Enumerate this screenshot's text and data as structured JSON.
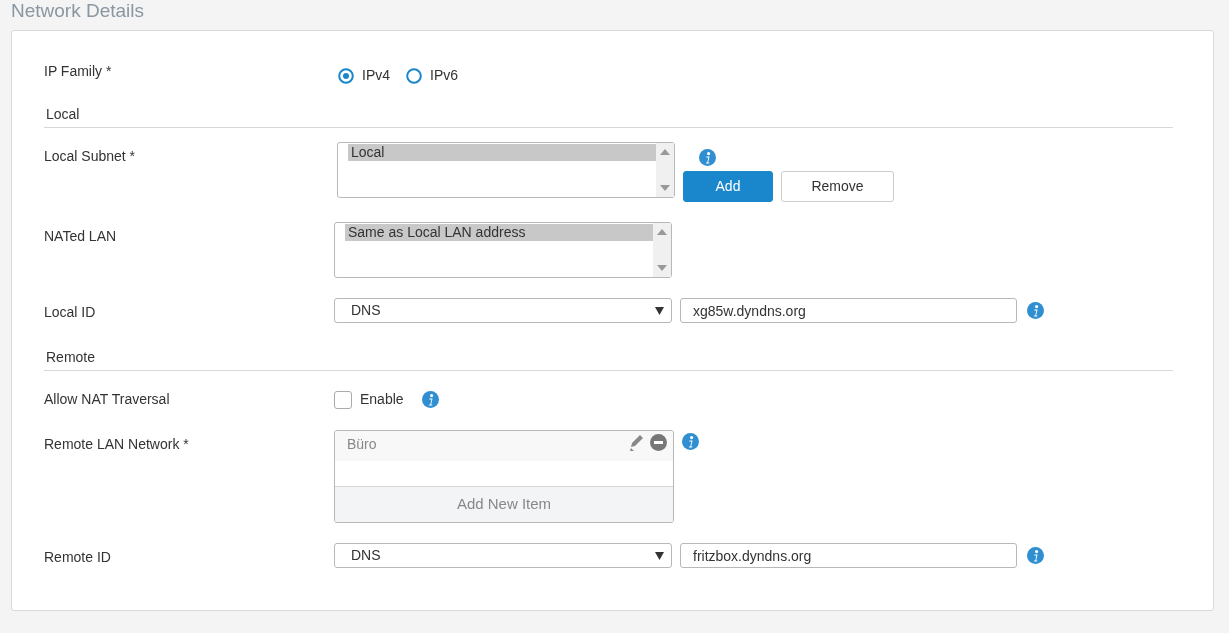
{
  "title": "Network Details",
  "ip_family": {
    "label": "IP Family *",
    "options": [
      {
        "label": "IPv4",
        "selected": true
      },
      {
        "label": "IPv6",
        "selected": false
      }
    ]
  },
  "sections": [
    {
      "heading": "Local",
      "fields": [
        {
          "kind": "listbox",
          "label": "Local Subnet *",
          "items": [
            {
              "text": "Local",
              "selected": true
            }
          ],
          "info": true,
          "buttons": [
            {
              "label": "Add",
              "kind": "primary"
            },
            {
              "label": "Remove",
              "kind": "default"
            }
          ]
        },
        {
          "kind": "listbox",
          "label": "NATed LAN",
          "items": [
            {
              "text": "Same as Local LAN address",
              "selected": true
            }
          ],
          "info": false
        },
        {
          "kind": "select_text",
          "label": "Local ID",
          "select": "DNS",
          "value": "xg85w.dyndns.org",
          "info": true
        }
      ]
    },
    {
      "heading": "Remote",
      "fields": [
        {
          "kind": "checkbox",
          "label": "Allow NAT Traversal",
          "option": "Enable",
          "checked": false,
          "info": true
        },
        {
          "kind": "item_list",
          "label": "Remote LAN Network *",
          "items": [
            {
              "text": "Büro"
            }
          ],
          "add_label": "Add New Item",
          "info": true
        },
        {
          "kind": "select_text",
          "label": "Remote ID",
          "select": "DNS",
          "value": "fritzbox.dyndns.org",
          "info": true
        }
      ]
    }
  ]
}
